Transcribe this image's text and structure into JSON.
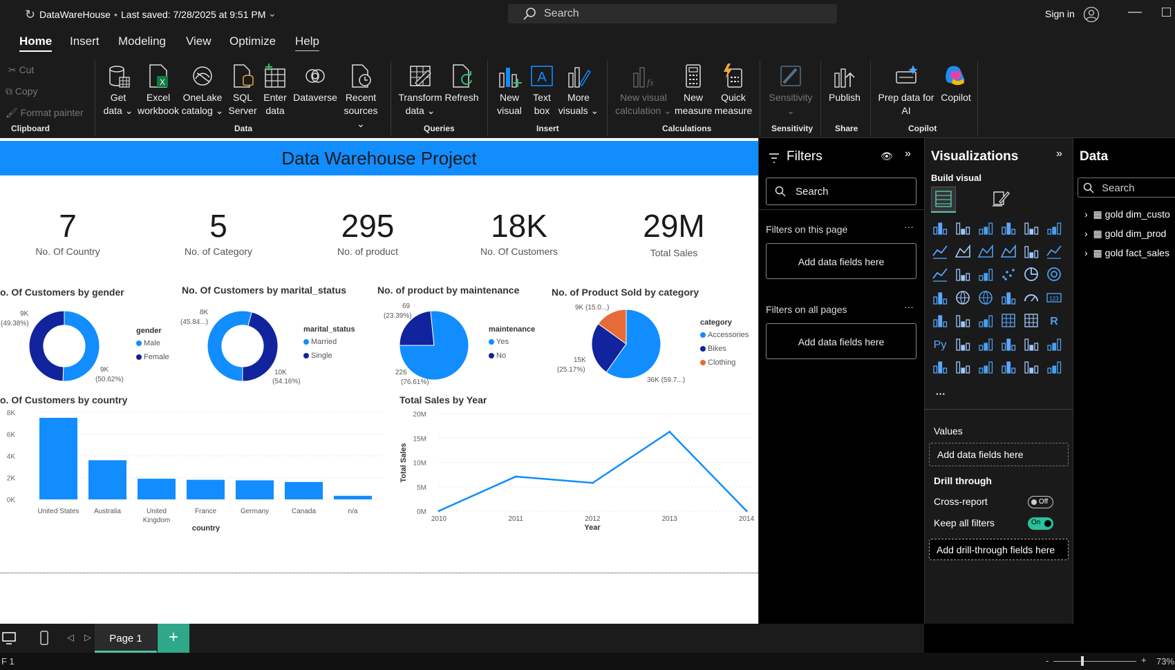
{
  "titlebar": {
    "file_name": "DataWareHouse",
    "saved": "Last saved: 7/28/2025 at 9:51 PM",
    "search": "Search",
    "sign_in": "Sign in"
  },
  "tabs": [
    "Home",
    "Insert",
    "Modeling",
    "View",
    "Optimize",
    "Help"
  ],
  "ribbon": {
    "clipboard": {
      "cut": "Cut",
      "copy": "Copy",
      "format_painter": "Format painter",
      "group": "Clipboard"
    },
    "data": {
      "get_data": [
        "Get",
        "data"
      ],
      "excel": [
        "Excel",
        "workbook"
      ],
      "onelake": [
        "OneLake",
        "catalog"
      ],
      "sql": [
        "SQL",
        "Server"
      ],
      "enter": [
        "Enter",
        "data"
      ],
      "dataverse": "Dataverse",
      "recent": [
        "Recent",
        "sources"
      ],
      "group": "Data"
    },
    "queries": {
      "transform": [
        "Transform",
        "data"
      ],
      "refresh": "Refresh",
      "group": "Queries"
    },
    "insert": {
      "new_visual": [
        "New",
        "visual"
      ],
      "text_box": [
        "Text",
        "box"
      ],
      "more_visuals": [
        "More",
        "visuals"
      ],
      "group": "Insert"
    },
    "calculations": {
      "new_visual_calc": [
        "New visual",
        "calculation"
      ],
      "new_measure": [
        "New",
        "measure"
      ],
      "quick_measure": [
        "Quick",
        "measure"
      ],
      "group": "Calculations"
    },
    "sensitivity": {
      "label": "Sensitivity",
      "group": "Sensitivity"
    },
    "share": {
      "publish": "Publish",
      "group": "Share"
    },
    "copilot": {
      "prep": [
        "Prep data for",
        "AI"
      ],
      "copilot": "Copilot",
      "group": "Copilot"
    }
  },
  "report": {
    "banner": "Data Warehouse Project",
    "kpis": [
      {
        "value": "7",
        "label": "No. Of Country"
      },
      {
        "value": "5",
        "label": "No. of Category"
      },
      {
        "value": "295",
        "label": "No. of product"
      },
      {
        "value": "18K",
        "label": "No. Of Customers"
      },
      {
        "value": "29M",
        "label": "Total Sales"
      }
    ],
    "gender_title": "o. Of Customers by gender",
    "gender_labels": [
      "9K",
      "(49.38%)",
      "9K",
      "(50.62%)"
    ],
    "gender_legend": {
      "title": "gender",
      "items": [
        "Male",
        "Female"
      ]
    },
    "marital_title": "No. Of Customers by marital_status",
    "marital_labels": [
      "8K",
      "(45.84...)",
      "10K",
      "(54.16%)"
    ],
    "marital_legend": {
      "title": "marital_status",
      "items": [
        "Married",
        "Single"
      ]
    },
    "maint_title": "No. of product by maintenance",
    "maint_labels": [
      "69",
      "(23.39%)",
      "226",
      "(76.61%)"
    ],
    "maint_legend": {
      "title": "maintenance",
      "items": [
        "Yes",
        "No"
      ]
    },
    "cat_title": "No. of Product Sold by category",
    "cat_labels": [
      "9K (15.0...)",
      "15K",
      "(25.17%)",
      "36K (59.7...)"
    ],
    "cat_legend": {
      "title": "category",
      "items": [
        "Accessories",
        "Bikes",
        "Clothing"
      ]
    },
    "country_title": "o. Of Customers by country",
    "sales_title": "Total Sales by Year"
  },
  "chart_data": [
    {
      "type": "pie",
      "title": "No. Of Customers by gender",
      "categories": [
        "Male",
        "Female"
      ],
      "values": [
        9000,
        9000
      ],
      "percent": [
        50.62,
        49.38
      ],
      "colors": [
        "#118dff",
        "#12239e"
      ]
    },
    {
      "type": "pie",
      "title": "No. Of Customers by marital_status",
      "categories": [
        "Married",
        "Single"
      ],
      "values": [
        8000,
        10000
      ],
      "percent": [
        45.84,
        54.16
      ],
      "colors": [
        "#12239e",
        "#118dff"
      ]
    },
    {
      "type": "pie",
      "title": "No. of product by maintenance",
      "categories": [
        "Yes",
        "No"
      ],
      "values": [
        69,
        226
      ],
      "percent": [
        23.39,
        76.61
      ],
      "colors": [
        "#12239e",
        "#118dff"
      ]
    },
    {
      "type": "pie",
      "title": "No. of Product Sold by category",
      "categories": [
        "Accessories",
        "Bikes",
        "Clothing"
      ],
      "values": [
        36000,
        15000,
        9000
      ],
      "percent": [
        59.7,
        25.17,
        15.0
      ],
      "colors": [
        "#118dff",
        "#12239e",
        "#e66c37"
      ]
    },
    {
      "type": "bar",
      "title": "No. Of Customers by country",
      "xlabel": "country",
      "categories": [
        "United States",
        "Australia",
        "United Kingdom",
        "France",
        "Germany",
        "Canada",
        "n/a"
      ],
      "values": [
        7500,
        3600,
        1900,
        1800,
        1750,
        1600,
        330
      ],
      "ylim": [
        0,
        8000
      ],
      "yticks": [
        "0K",
        "2K",
        "4K",
        "6K",
        "8K"
      ],
      "color": "#118dff"
    },
    {
      "type": "line",
      "title": "Total Sales by Year",
      "xlabel": "Year",
      "ylabel": "Total Sales",
      "x": [
        "2010",
        "2011",
        "2012",
        "2013",
        "2014"
      ],
      "values": [
        0.04,
        7.1,
        5.8,
        16.3,
        0.05
      ],
      "unit": "M",
      "ylim": [
        0,
        20
      ],
      "yticks": [
        "0M",
        "5M",
        "10M",
        "15M",
        "20M"
      ],
      "color": "#118dff"
    }
  ],
  "filters": {
    "title": "Filters",
    "search": "Search",
    "on_page": "Filters on this page",
    "on_all": "Filters on all pages",
    "add": "Add data fields here"
  },
  "visualizations": {
    "title": "Visualizations",
    "build": "Build visual",
    "values": "Values",
    "add_fields": "Add data fields here",
    "drill": "Drill through",
    "cross": "Cross-report",
    "cross_state": "Off",
    "keep": "Keep all filters",
    "keep_state": "On",
    "add_drill": "Add drill-through fields here"
  },
  "data_pane": {
    "title": "Data",
    "search": "Search",
    "tables": [
      "gold dim_custo",
      "gold dim_prod",
      "gold fact_sales"
    ]
  },
  "pages": {
    "current": "Page 1"
  },
  "status": {
    "left": "F 1",
    "zoom": "73%"
  }
}
